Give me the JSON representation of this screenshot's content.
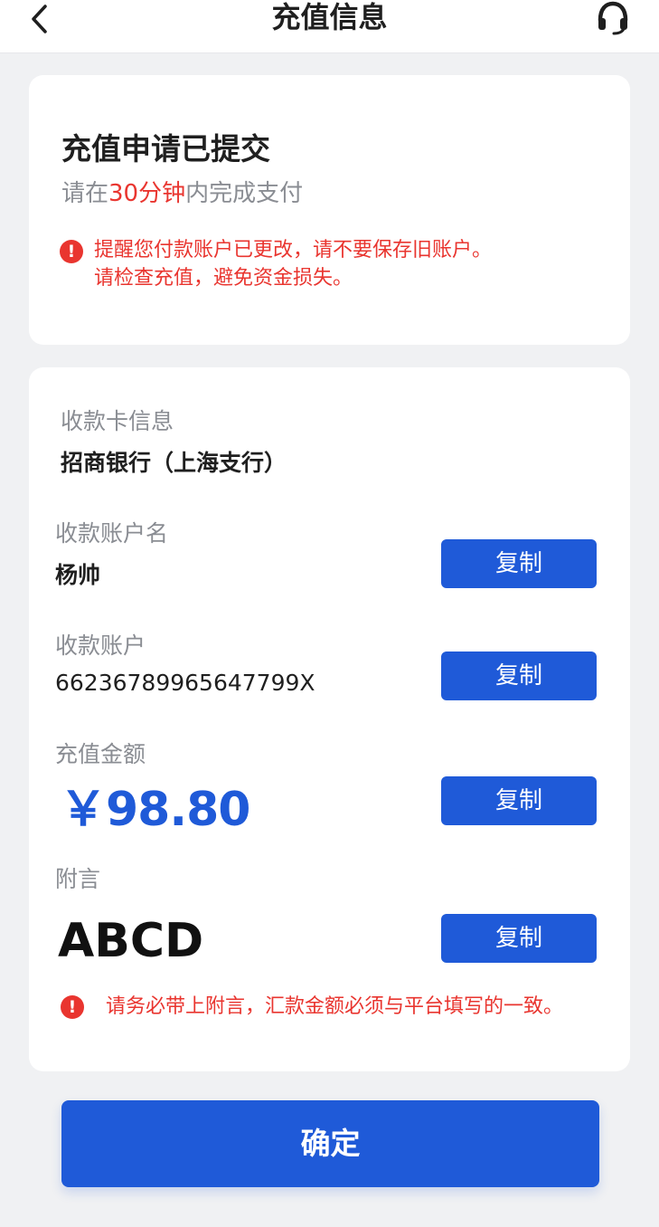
{
  "header": {
    "title": "充值信息",
    "back_icon": "chevron-left-icon",
    "service_icon": "headset-icon"
  },
  "status_card": {
    "title": "充值申请已提交",
    "subtitle_prefix": "请在",
    "subtitle_highlight": "30分钟",
    "subtitle_suffix": "内完成支付",
    "warning_line1": "提醒您付款账户已更改，请不要保存旧账户。",
    "warning_line2": "请检查充值，避免资金损失。"
  },
  "payment_info": {
    "bank_label": "收款卡信息",
    "bank_value": "招商银行（上海支行）",
    "name_label": "收款账户名",
    "name_value": "杨帅",
    "account_label": "收款账户",
    "account_value": "66236789965647799X",
    "amount_label": "充值金额",
    "amount_value": "￥98.80",
    "memo_label": "附言",
    "memo_value": "ABCD",
    "copy_label": "复制",
    "notice": "请务必带上附言，汇款金额必须与平台填写的一致。"
  },
  "confirm_label": "确定",
  "colors": {
    "accent": "#1f5ad8",
    "warning": "#e9352f",
    "background": "#f0f1f3"
  }
}
